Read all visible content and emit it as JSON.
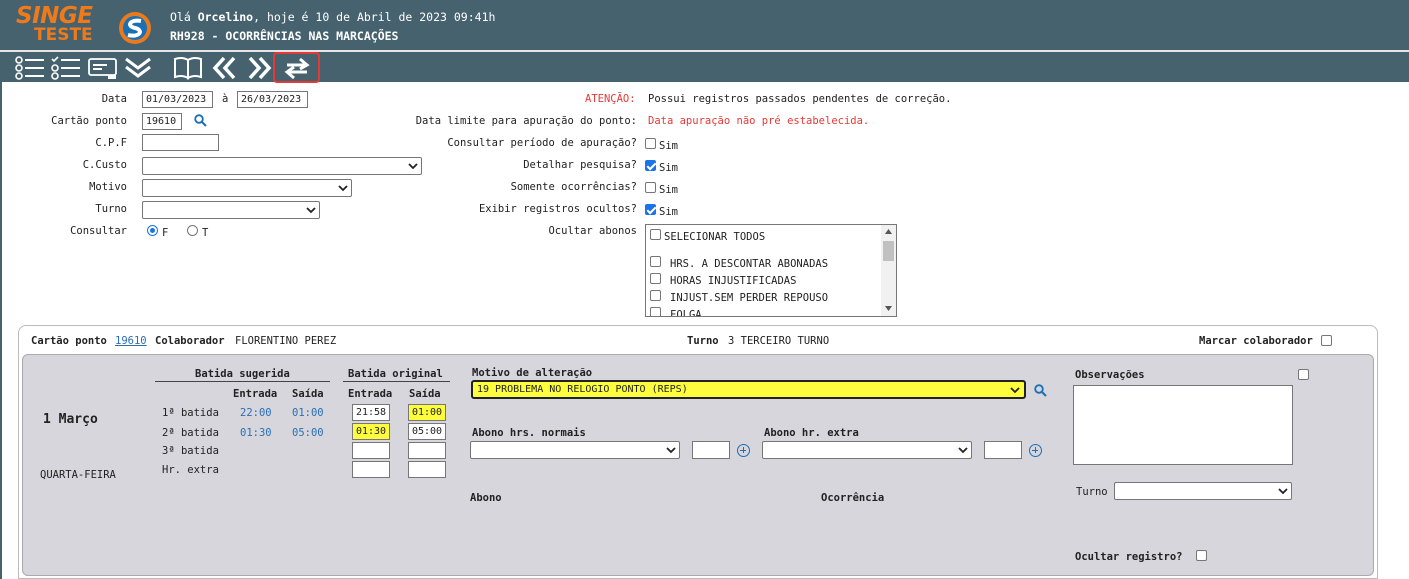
{
  "header": {
    "logo_main": "SINGE",
    "logo_sub": "TESTE",
    "greeting_prefix": "Olá ",
    "user": "Orcelino",
    "greeting_suffix": ", hoje é 10 de Abril de 2023 09:41h",
    "title": "RH928 - OCORRÊNCIAS NAS MARCAÇÕES"
  },
  "toolbar": {
    "icons": [
      "list-icon",
      "checklist-icon",
      "card-icon",
      "double-chevron-down-icon",
      "book-icon",
      "double-chevron-left-icon",
      "double-chevron-right-icon",
      "swap-icon"
    ]
  },
  "form": {
    "data_label": "Data",
    "data_from": "01/03/2023",
    "data_sep": "à",
    "data_to": "26/03/2023",
    "cartao_label": "Cartão ponto",
    "cartao_value": "19610",
    "cpf_label": "C.P.F",
    "cpf_value": "",
    "ccusto_label": "C.Custo",
    "motivo_label": "Motivo",
    "turno_label": "Turno",
    "consultar_label": "Consultar",
    "consultar_opt_f": "F",
    "consultar_opt_t": "T",
    "atencao_label": "ATENÇÃO:",
    "atencao_text": "Possui registros passados pendentes de correção.",
    "data_limite_label": "Data limite para apuração do ponto:",
    "data_limite_value": "Data apuração não pré estabelecida.",
    "consultar_periodo_label": "Consultar período de apuração?",
    "detalhar_label": "Detalhar pesquisa?",
    "somente_label": "Somente ocorrências?",
    "exibir_label": "Exibir registros ocultos?",
    "sim": "Sim",
    "ocultar_abonos_label": "Ocultar abonos",
    "abonos_options": [
      "SELECIONAR TODOS",
      "HRS. A DESCONTAR ABONADAS",
      "HORAS INJUSTIFICADAS",
      "INJUST.SEM PERDER REPOUSO",
      "FOLGA"
    ]
  },
  "colab": {
    "cartao_label": "Cartão ponto",
    "cartao_value": "19610",
    "colaborador_label": "Colaborador",
    "colaborador_value": "FLORENTINO PEREZ",
    "turno_label": "Turno",
    "turno_value": "3 TERCEIRO TURNO",
    "marcar_label": "Marcar colaborador"
  },
  "day": {
    "date": "1 Março",
    "weekday": "QUARTA-FEIRA",
    "sugerida_header": "Batida sugerida",
    "original_header": "Batida original",
    "entrada": "Entrada",
    "saida": "Saída",
    "rows": [
      {
        "label": "1ª batida",
        "sug_entrada": "22:00",
        "sug_saida": "01:00",
        "orig_entrada": "21:58",
        "orig_saida": "01:00"
      },
      {
        "label": "2ª batida",
        "sug_entrada": "01:30",
        "sug_saida": "05:00",
        "orig_entrada": "01:30",
        "orig_saida": "05:00"
      },
      {
        "label": "3ª batida",
        "sug_entrada": "",
        "sug_saida": "",
        "orig_entrada": "",
        "orig_saida": ""
      },
      {
        "label": "Hr. extra",
        "sug_entrada": "",
        "sug_saida": "",
        "orig_entrada": "",
        "orig_saida": ""
      }
    ],
    "motivo_label": "Motivo de alteração",
    "motivo_value": "19 PROBLEMA NO RELOGIO PONTO (REPS)",
    "abono_normais_label": "Abono hrs. normais",
    "abono_extra_label": "Abono hr. extra",
    "abono_label": "Abono",
    "ocorrencia_label": "Ocorrência",
    "observacoes_label": "Observações",
    "turno_label": "Turno",
    "ocultar_label": "Ocultar registro?"
  },
  "colors": {
    "header_bg": "#46626f",
    "logo_orange": "#f07a1a",
    "alert_red": "#e53935",
    "highlight_yellow": "#fdfd3d",
    "link_blue": "#2a6fb5"
  }
}
